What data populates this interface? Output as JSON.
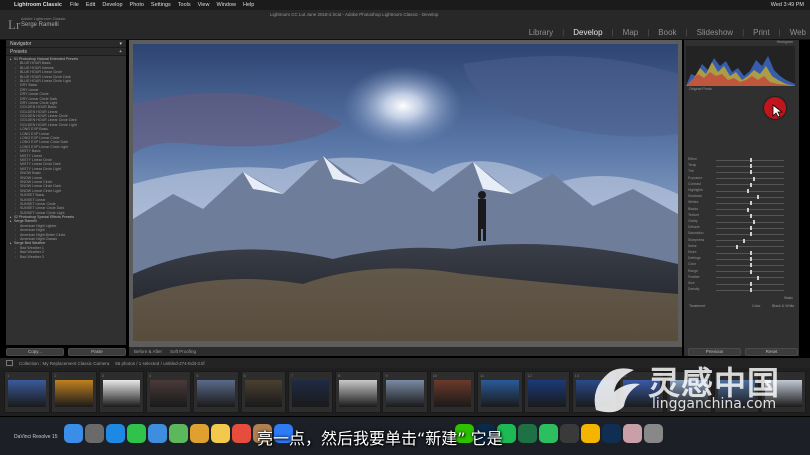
{
  "menubar": {
    "app_name": "Lightroom Classic",
    "items": [
      "File",
      "Edit",
      "Develop",
      "Photo",
      "Settings",
      "Tools",
      "View",
      "Window",
      "Help"
    ],
    "clock": "Wed 3:49 PM"
  },
  "header": {
    "logo": "Lr",
    "user_line1": "Adobe Lightroom Classic",
    "user_name": "Serge Ramelli",
    "window_title": "Lightroom CC Lut June 2018-2.lrcat - Adobe Photoshop Lightroom Classic - Develop",
    "modules": [
      "Library",
      "Develop",
      "Map",
      "Book",
      "Slideshow",
      "Print",
      "Web"
    ],
    "active_module": "Develop"
  },
  "left_panel": {
    "navigator_label": "Navigator",
    "presets_label": "Presets",
    "presets": [
      {
        "label": "01 Photoshop Natural Extended Presets",
        "folder": true
      },
      {
        "label": "BLUE HOUR Basic",
        "folder": false
      },
      {
        "label": "BLUE HOUR Intense",
        "folder": false
      },
      {
        "label": "BLUE HOUR Linear Circle",
        "folder": false
      },
      {
        "label": "BLUE HOUR Linear Circle Dark",
        "folder": false
      },
      {
        "label": "BLUE HOUR Linear Circle Light",
        "folder": false
      },
      {
        "label": "DRY Basic",
        "folder": false
      },
      {
        "label": "DRY Linear",
        "folder": false
      },
      {
        "label": "DRY Linear Circle",
        "folder": false
      },
      {
        "label": "DRY Linear Circle Dark",
        "folder": false
      },
      {
        "label": "DRY Linear Circle Light",
        "folder": false
      },
      {
        "label": "GOLDEN HOUR Basic",
        "folder": false
      },
      {
        "label": "GOLDEN HOUR Linear",
        "folder": false
      },
      {
        "label": "GOLDEN HOUR Linear Circle",
        "folder": false
      },
      {
        "label": "GOLDEN HOUR Linear Circle Dark",
        "folder": false
      },
      {
        "label": "GOLDEN HOUR Linear Circle Light",
        "folder": false
      },
      {
        "label": "LONG EXP Basic",
        "folder": false
      },
      {
        "label": "LONG EXP Linear",
        "folder": false
      },
      {
        "label": "LONG EXP Linear Circle",
        "folder": false
      },
      {
        "label": "LONG EXP Linear Circle Dark",
        "folder": false
      },
      {
        "label": "LONG EXP Linear Circle Light",
        "folder": false
      },
      {
        "label": "MISTY Basic",
        "folder": false
      },
      {
        "label": "MISTY Linear",
        "folder": false
      },
      {
        "label": "MISTY Linear Circle",
        "folder": false
      },
      {
        "label": "MISTY Linear Circle Dark",
        "folder": false
      },
      {
        "label": "MISTY Linear Circle Light",
        "folder": false
      },
      {
        "label": "SNOW Basic",
        "folder": false
      },
      {
        "label": "SNOW Linear",
        "folder": false
      },
      {
        "label": "SNOW Linear Circle",
        "folder": false
      },
      {
        "label": "SNOW Linear Circle Dark",
        "folder": false
      },
      {
        "label": "SNOW Linear Circle Light",
        "folder": false
      },
      {
        "label": "SUNSET Basic",
        "folder": false
      },
      {
        "label": "SUNSET Linear",
        "folder": false
      },
      {
        "label": "SUNSET Linear Circle",
        "folder": false
      },
      {
        "label": "SUNSET Linear Circle Dark",
        "folder": false
      },
      {
        "label": "SUNSET Linear Circle Light",
        "folder": false
      },
      {
        "label": "02 Photoshop Special Effects Presets",
        "folder": true
      },
      {
        "label": "Serge Ramelli",
        "folder": true
      },
      {
        "label": "American Night Lighter",
        "folder": false
      },
      {
        "label": "American Night",
        "folder": false
      },
      {
        "label": "American Night Better Circle",
        "folder": false
      },
      {
        "label": "American Night Classic",
        "folder": false
      },
      {
        "label": "Serge Bed Weather",
        "folder": true
      },
      {
        "label": "Bad Weather 1",
        "folder": false
      },
      {
        "label": "Bad Weather 2",
        "folder": false
      },
      {
        "label": "Bad Weather 3",
        "folder": false
      }
    ],
    "copy_label": "Copy...",
    "paste_label": "Paste"
  },
  "toolbar": {
    "before_after": "Before & After",
    "soft_proofing": "Soft Proofing"
  },
  "right_panel": {
    "histogram_label": "Histogram",
    "original_photo": "Original Photo",
    "adjustments": [
      "Effect",
      "Temp",
      "Tint",
      "Exposure",
      "Contrast",
      "Highlights",
      "Shadows",
      "Whites",
      "Blacks",
      "Texture",
      "Clarity",
      "Dehaze",
      "Saturation",
      "Sharpness",
      "Noise",
      "Moire",
      "Defringe",
      "Color",
      "Range",
      "Feather",
      "Size",
      "Density"
    ],
    "basic_label": "Basic",
    "treatment_label": "Treatment",
    "treatment_color": "Color",
    "treatment_bw": "Black & White",
    "previous_label": "Previous",
    "reset_label": "Reset"
  },
  "filmstrip": {
    "path": "Collection : My Replacement Classic Camera",
    "count": "55 photos / 1 selected / untitled-274-Edit-3.tif",
    "thumbs": [
      "1",
      "2",
      "3",
      "4",
      "5",
      "6",
      "7",
      "8",
      "9",
      "10",
      "11",
      "12",
      "13",
      "14",
      "15",
      "16",
      "17"
    ]
  },
  "dock": {
    "app_label": "DaVinci Resolve 15"
  },
  "overlay": {
    "subtitle": "亮一点，然后我要单击“新建” 它是",
    "watermark_cn": "灵感中国",
    "watermark_url": "lingganchina.com"
  },
  "colors": {
    "accent_red": "#c0151d",
    "panel_bg": "#303030",
    "photo_sky": "#3c5a8a"
  },
  "icons": [
    "apple-icon",
    "cursor-icon",
    "mask-tool-icon",
    "trash-icon",
    "finder-icon"
  ]
}
